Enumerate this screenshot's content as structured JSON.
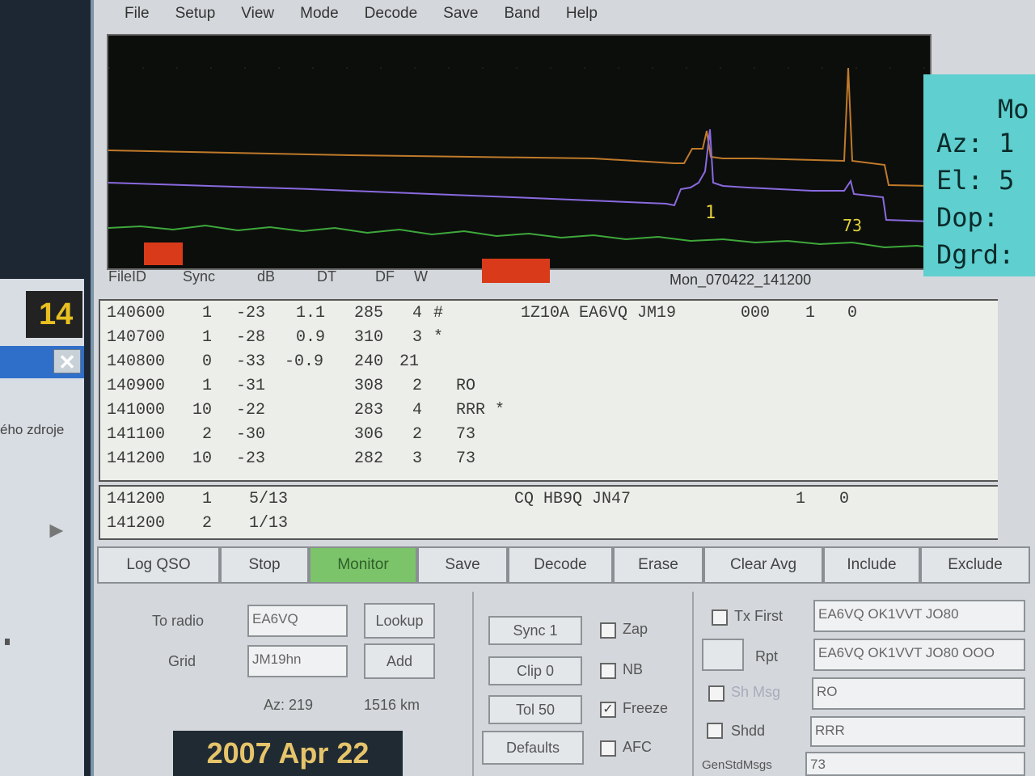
{
  "background_window": {
    "time_fragment": "14",
    "close_glyph": "✕",
    "text_fragment": "ého zdroje"
  },
  "menu": [
    "File",
    "Setup",
    "View",
    "Mode",
    "Decode",
    "Save",
    "Band",
    "Help"
  ],
  "moon_panel": {
    "title": "Mo",
    "az": "Az: 1",
    "el": "El:  5",
    "dop": "Dop:",
    "dgrd": "Dgrd:"
  },
  "spectrum": {
    "marker_1": "1",
    "marker_73": "73"
  },
  "columns": {
    "fileid": "FileID",
    "sync": "Sync",
    "db": "dB",
    "dt": "DT",
    "df": "DF",
    "w": "W"
  },
  "file_label": "Mon_070422_141200",
  "decodes": [
    {
      "fileid": "140600",
      "sync": "1",
      "db": "-23",
      "dt": "1.1",
      "df": "285",
      "w": "4",
      "flag": "#",
      "msg": "1Z10A EA6VQ JM19",
      "n1": "000",
      "n2": "1",
      "n3": "0"
    },
    {
      "fileid": "140700",
      "sync": "1",
      "db": "-28",
      "dt": "0.9",
      "df": "310",
      "w": "3",
      "flag": "*",
      "msg": "",
      "n1": "",
      "n2": "",
      "n3": ""
    },
    {
      "fileid": "140800",
      "sync": "0",
      "db": "-33",
      "dt": "-0.9",
      "df": "240",
      "w": "21",
      "flag": "",
      "msg": "",
      "n1": "",
      "n2": "",
      "n3": ""
    },
    {
      "fileid": "140900",
      "sync": "1",
      "db": "-31",
      "dt": "",
      "df": "308",
      "w": "2",
      "flag": "RO",
      "msg": "",
      "n1": "",
      "n2": "",
      "n3": ""
    },
    {
      "fileid": "141000",
      "sync": "10",
      "db": "-22",
      "dt": "",
      "df": "283",
      "w": "4",
      "flag": "RRR *",
      "msg": "",
      "n1": "",
      "n2": "",
      "n3": ""
    },
    {
      "fileid": "141100",
      "sync": "2",
      "db": "-30",
      "dt": "",
      "df": "306",
      "w": "2",
      "flag": "73",
      "msg": "",
      "n1": "",
      "n2": "",
      "n3": ""
    },
    {
      "fileid": "141200",
      "sync": "10",
      "db": "-23",
      "dt": "",
      "df": "282",
      "w": "3",
      "flag": "73",
      "msg": "",
      "n1": "",
      "n2": "",
      "n3": ""
    }
  ],
  "averages": [
    {
      "fileid": "141200",
      "sync": "1",
      "ratio": "5/13",
      "msg": "CQ HB9Q JN47",
      "n1": "1",
      "n2": "0"
    },
    {
      "fileid": "141200",
      "sync": "2",
      "ratio": "1/13",
      "msg": "",
      "n1": "",
      "n2": ""
    }
  ],
  "buttons": {
    "log_qso": "Log QSO",
    "stop": "Stop",
    "monitor": "Monitor",
    "save": "Save",
    "decode": "Decode",
    "erase": "Erase",
    "clear_avg": "Clear Avg",
    "include": "Include",
    "exclude": "Exclude"
  },
  "station": {
    "to_radio_label": "To radio",
    "to_radio_value": "EA6VQ",
    "lookup": "Lookup",
    "grid_label": "Grid",
    "grid_value": "JM19hn",
    "add": "Add",
    "az": "Az: 219",
    "distance": "1516 km",
    "date": "2007 Apr 22"
  },
  "controls": {
    "sync": "Sync  1",
    "clip": "Clip  0",
    "tol": "Tol   50",
    "defaults": "Defaults",
    "zap": "Zap",
    "nb": "NB",
    "freeze": "Freeze",
    "freeze_checked": "✓",
    "afc": "AFC"
  },
  "tx_panel": {
    "tx_first": "Tx First",
    "tx1": "EA6VQ OK1VVT JO80",
    "rpt": "Rpt",
    "tx2": "EA6VQ OK1VVT JO80 OOO",
    "sh_msg": "Sh Msg",
    "tx3": "RO",
    "shdd": "Shdd",
    "tx4": "RRR",
    "gen_std_msgs": "GenStdMsgs",
    "tx5": "73"
  }
}
